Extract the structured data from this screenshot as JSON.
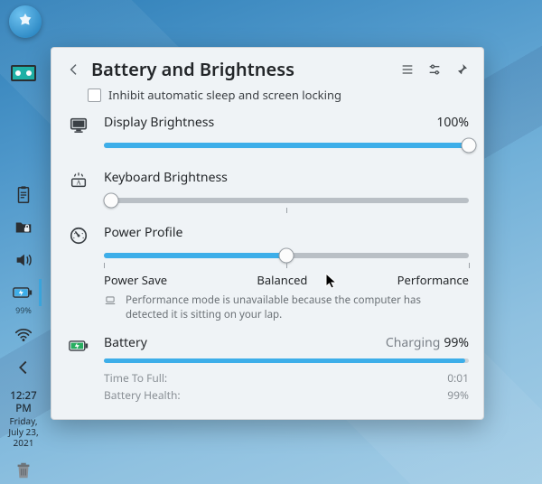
{
  "header": {
    "title": "Battery and Brightness"
  },
  "inhibit": {
    "label": "Inhibit automatic sleep and screen locking",
    "checked": false
  },
  "display_brightness": {
    "label": "Display Brightness",
    "value_text": "100%",
    "percent": 100
  },
  "keyboard_brightness": {
    "label": "Keyboard Brightness",
    "percent": 2
  },
  "power_profile": {
    "label": "Power Profile",
    "percent": 50,
    "labels": {
      "low": "Power Save",
      "mid": "Balanced",
      "high": "Performance"
    },
    "note": "Performance mode is unavailable because the computer has detected it is sitting on your lap."
  },
  "battery": {
    "label": "Battery",
    "state": "Charging",
    "percent_text": "99%",
    "percent": 99,
    "details": {
      "time_to_full_label": "Time To Full:",
      "time_to_full_value": "0:01",
      "health_label": "Battery Health:",
      "health_value": "99%"
    }
  },
  "panel": {
    "battery_percent": "99%",
    "clock": {
      "time": "12:27 PM",
      "weekday": "Friday,",
      "date": "July 23,",
      "year": "2021"
    }
  },
  "colors": {
    "accent": "#3daee9"
  }
}
